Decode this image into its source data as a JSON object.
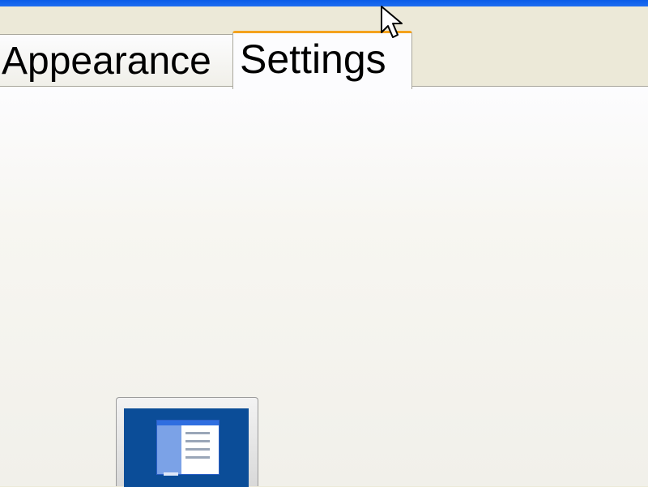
{
  "tabs": [
    {
      "label": "Appearance",
      "active": false
    },
    {
      "label": "Settings",
      "active": true
    }
  ],
  "colors": {
    "titlebar": "#0a5ce8",
    "dialog_background": "#ece9d8",
    "panel_background": "#fcfcfe",
    "active_tab_accent": "#f4a21d",
    "preview_desktop": "#0b4d98"
  },
  "icons": {
    "cursor": "arrow-cursor-icon",
    "preview": "monitor-preview-icon"
  }
}
